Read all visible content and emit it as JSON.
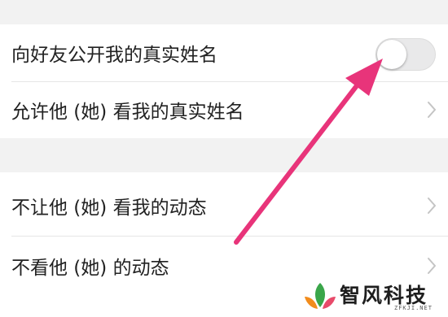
{
  "settings": {
    "rows": [
      {
        "label": "向好友公开我的真实姓名",
        "control": "toggle",
        "checked": false
      },
      {
        "label": "允许他 (她) 看我的真实姓名",
        "control": "chevron"
      },
      {
        "label": "不让他 (她) 看我的动态",
        "control": "chevron"
      },
      {
        "label": "不看他 (她) 的动态",
        "control": "chevron"
      }
    ]
  },
  "annotation": {
    "type": "arrow",
    "color": "#e8347a",
    "points_to": "real-name-toggle"
  },
  "watermark": {
    "title": "智风科技",
    "subtitle": "ZFKJI.NET",
    "colors": [
      "#3aa64a",
      "#f28c1c",
      "#e84a6a"
    ]
  },
  "colors": {
    "background": "#f2f2f2",
    "row": "#ffffff",
    "text": "#222222",
    "chevron": "#c4c4c4"
  }
}
